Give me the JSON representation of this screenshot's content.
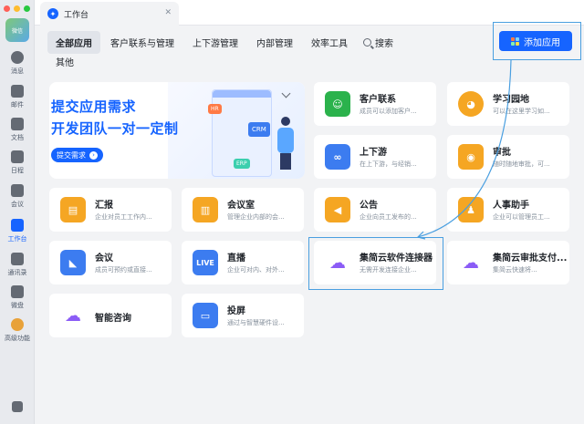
{
  "window": {
    "title": "工作台"
  },
  "sidebar": {
    "avatar_text": "微信",
    "items": [
      {
        "label": "消息",
        "icon": "chat-bubble-icon"
      },
      {
        "label": "邮件",
        "icon": "mail-icon"
      },
      {
        "label": "文档",
        "icon": "document-icon"
      },
      {
        "label": "日程",
        "icon": "calendar-icon"
      },
      {
        "label": "会议",
        "icon": "meeting-icon"
      },
      {
        "label": "工作台",
        "icon": "grid-icon"
      },
      {
        "label": "通讯录",
        "icon": "contacts-icon"
      },
      {
        "label": "微盘",
        "icon": "drive-icon"
      },
      {
        "label": "高级功能",
        "icon": "premium-icon"
      }
    ]
  },
  "categories": {
    "tabs": [
      "全部应用",
      "客户联系与管理",
      "上下游管理",
      "内部管理",
      "效率工具"
    ],
    "search_label": "搜索",
    "other_label": "其他"
  },
  "toolbar": {
    "add_app_label": "添加应用"
  },
  "banner": {
    "line1": "提交应用需求",
    "line2": "开发团队一对一定制",
    "button": "提交需求",
    "tags": [
      "HR",
      "CRM",
      "ERP"
    ]
  },
  "apps": [
    {
      "name": "客户联系",
      "desc": "成员可以添加客户...",
      "color": "#2bb24c",
      "glyph": "☺"
    },
    {
      "name": "学习园地",
      "desc": "可以在这里学习如...",
      "color": "#f5a623",
      "glyph": "◕"
    },
    {
      "name": "上下游",
      "desc": "在上下游，与经销...",
      "color": "#3c7cf0",
      "glyph": "∞"
    },
    {
      "name": "审批",
      "desc": "随时随地审批，可...",
      "color": "#f5a623",
      "glyph": "◉"
    },
    {
      "name": "汇报",
      "desc": "企业对员工工作内...",
      "color": "#f5a623",
      "glyph": "▤"
    },
    {
      "name": "会议室",
      "desc": "管理企业内部的会...",
      "color": "#f5a623",
      "glyph": "▥"
    },
    {
      "name": "公告",
      "desc": "企业向员工发布的...",
      "color": "#f5a623",
      "glyph": "◀"
    },
    {
      "name": "人事助手",
      "desc": "企业可以管理员工...",
      "color": "#f5a623",
      "glyph": "♟"
    },
    {
      "name": "会议",
      "desc": "成员可预约或直接...",
      "color": "#3c7cf0",
      "glyph": "◣"
    },
    {
      "name": "直播",
      "desc": "企业可对内、对外...",
      "color": "#3c7cf0",
      "glyph": "LIVE"
    },
    {
      "name": "集简云软件连接器",
      "desc": "无需开发连接企业...",
      "color": "#ffffff",
      "glyph": "☁"
    },
    {
      "name": "集简云审批支付...",
      "desc": "集简云快速将...",
      "color": "#ffffff",
      "glyph": "☁"
    },
    {
      "name": "智能咨询",
      "desc": "",
      "color": "#ffffff",
      "glyph": "☁"
    },
    {
      "name": "投屏",
      "desc": "通过与智慧硬件设...",
      "color": "#3c7cf0",
      "glyph": "▭"
    }
  ]
}
